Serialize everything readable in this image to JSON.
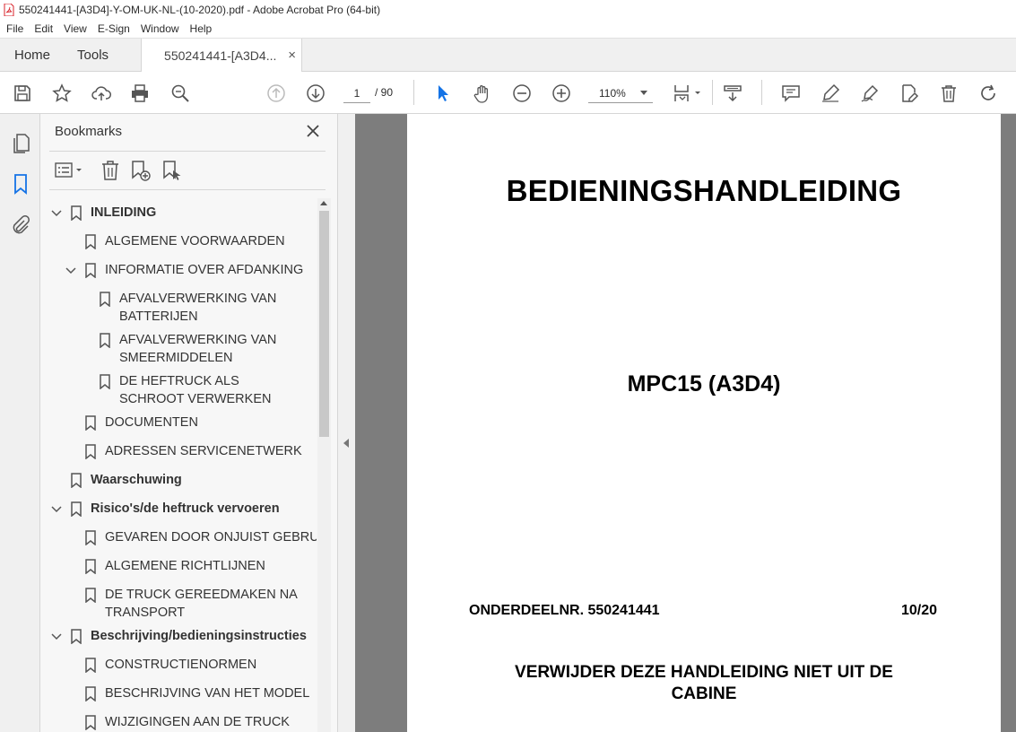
{
  "window": {
    "title": "550241441-[A3D4]-Y-OM-UK-NL-(10-2020).pdf - Adobe Acrobat Pro (64-bit)"
  },
  "menu": [
    "File",
    "Edit",
    "View",
    "E-Sign",
    "Window",
    "Help"
  ],
  "tabs": {
    "home": "Home",
    "tools": "Tools",
    "document": "550241441-[A3D4...",
    "close": "×"
  },
  "toolbar": {
    "page_current": "1",
    "page_total": "/ 90",
    "zoom": "110%"
  },
  "bookmarks": {
    "title": "Bookmarks",
    "items": [
      {
        "label": "INLEIDING",
        "bold": true,
        "level": 0,
        "expanded": true
      },
      {
        "label": "ALGEMENE VOORWAARDEN",
        "level": 1
      },
      {
        "label": "INFORMATIE OVER AFDANKING",
        "level": 1,
        "expanded": true
      },
      {
        "label": "AFVALVERWERKING VAN BATTERIJEN",
        "level": 2
      },
      {
        "label": "AFVALVERWERKING VAN SMEERMIDDELEN",
        "level": 2
      },
      {
        "label": "DE HEFTRUCK ALS SCHROOT VERWERKEN",
        "level": 2
      },
      {
        "label": "DOCUMENTEN",
        "level": 1
      },
      {
        "label": "ADRESSEN SERVICENETWERK",
        "level": 1
      },
      {
        "label": "Waarschuwing",
        "bold": true,
        "level": 0
      },
      {
        "label": "Risico's/de heftruck vervoeren",
        "bold": true,
        "level": 0,
        "expanded": true
      },
      {
        "label": "GEVAREN DOOR ONJUIST GEBRUIK",
        "level": 1
      },
      {
        "label": "ALGEMENE RICHTLIJNEN",
        "level": 1
      },
      {
        "label": "DE TRUCK GEREEDMAKEN NA TRANSPORT",
        "level": 1
      },
      {
        "label": "Beschrijving/bedieningsinstructies",
        "bold": true,
        "level": 0,
        "expanded": true
      },
      {
        "label": "CONSTRUCTIENORMEN",
        "level": 1
      },
      {
        "label": "BESCHRIJVING VAN HET MODEL",
        "level": 1
      },
      {
        "label": "WIJZIGINGEN AAN DE TRUCK",
        "level": 1
      }
    ]
  },
  "document": {
    "title": "BEDIENINGSHANDLEIDING",
    "model": "MPC15 (A3D4)",
    "part_number": "ONDERDEELNR. 550241441",
    "edition": "10/20",
    "notice": "VERWIJDER DEZE HANDLEIDING NIET UIT DE CABINE"
  },
  "colors": {
    "accent": "#1473e6",
    "viewer_bg": "#7d7d7d",
    "icon": "#555555"
  }
}
